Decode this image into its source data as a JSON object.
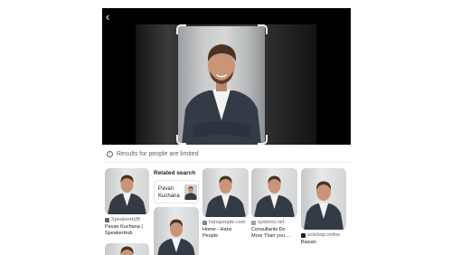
{
  "viewer": {
    "back_icon": "back-arrow-icon",
    "back_glyph": "‹"
  },
  "notice": {
    "icon": "info-icon",
    "glyph": "!",
    "text": "Results for people are limited"
  },
  "related": {
    "title": "Related search",
    "chip_name": "Pavan\nKuchana"
  },
  "results": [
    {
      "source": "SpeakerHUB",
      "caption": "Pavan Kuchana |\nSpeakerHub",
      "favicon_color": "#5f6368"
    },
    {
      "source": "hanspeople.com",
      "caption": "Home - Hans\nPeople",
      "favicon_color": "#7b8a9a"
    },
    {
      "source": "systemx.net",
      "caption": "Consultants Do\nMore Than you ...",
      "favicon_color": "#9aa0a6"
    },
    {
      "source": "sciishop.online",
      "caption": "Biasan",
      "favicon_color": "#202124"
    }
  ],
  "colors": {
    "jacket": "#343b47",
    "skin": "#c89579",
    "hair": "#4a3323",
    "shirt": "#f4f4f2"
  }
}
